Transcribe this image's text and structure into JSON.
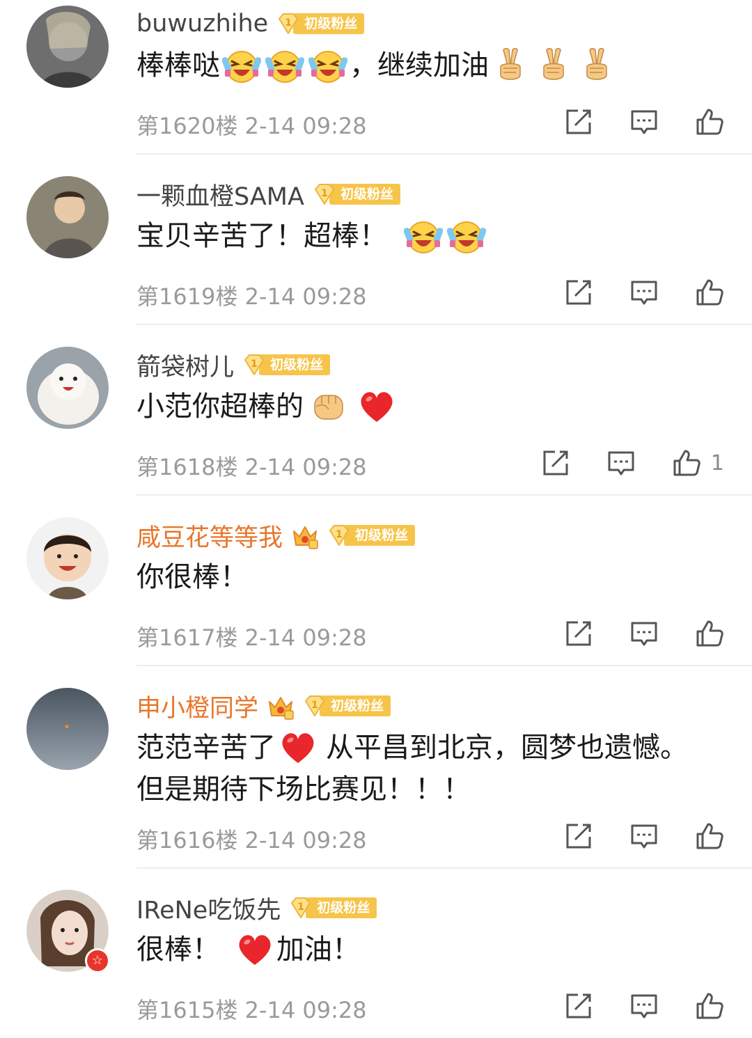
{
  "comments": [
    {
      "username": "buwuzhihe",
      "vip": false,
      "fan_badge": "初级粉丝",
      "fan_level": "1",
      "content_parts": [
        "棒棒哒",
        "[laughing-tears-emoji]",
        "[laughing-tears-emoji]",
        "[laughing-tears-emoji]",
        "，继续加油",
        "[victory-hand-emoji]",
        "[victory-hand-emoji]",
        "[victory-hand-emoji]"
      ],
      "text_1": "棒棒哒",
      "text_2": "，继续加油",
      "floor": "第1620楼",
      "time": "2-14 09:28",
      "likes": ""
    },
    {
      "username": "一颗血橙SAMA",
      "vip": false,
      "fan_badge": "初级粉丝",
      "fan_level": "1",
      "text_1": "宝贝辛苦了！超棒！",
      "floor": "第1619楼",
      "time": "2-14 09:28",
      "likes": ""
    },
    {
      "username": "箭袋树儿",
      "vip": false,
      "fan_badge": "初级粉丝",
      "fan_level": "1",
      "text_1": "小范你超棒的",
      "floor": "第1618楼",
      "time": "2-14 09:28",
      "likes": "1"
    },
    {
      "username": "咸豆花等等我",
      "vip": true,
      "fan_badge": "初级粉丝",
      "fan_level": "1",
      "text_1": "你很棒！",
      "floor": "第1617楼",
      "time": "2-14 09:28",
      "likes": ""
    },
    {
      "username": "申小橙同学",
      "vip": true,
      "fan_badge": "初级粉丝",
      "fan_level": "1",
      "text_1": "范范辛苦了",
      "text_2": "从平昌到北京，圆梦也遗憾。",
      "text_3": "但是期待下场比赛见！！！",
      "floor": "第1616楼",
      "time": "2-14 09:28",
      "likes": ""
    },
    {
      "username": "IReNe吃饭先",
      "vip": false,
      "fan_badge": "初级粉丝",
      "fan_level": "1",
      "text_1": "很棒！",
      "text_2": "加油！",
      "floor": "第1615楼",
      "time": "2-14 09:28",
      "likes": ""
    }
  ],
  "icons": {
    "share": "share-icon",
    "reply": "comment-icon",
    "like": "thumbs-up-icon"
  },
  "colors": {
    "vip_name": "#e8762b",
    "fan_badge_bg": "#f7c44a",
    "meta_text": "#9a9a9a",
    "divider": "#ededed"
  }
}
